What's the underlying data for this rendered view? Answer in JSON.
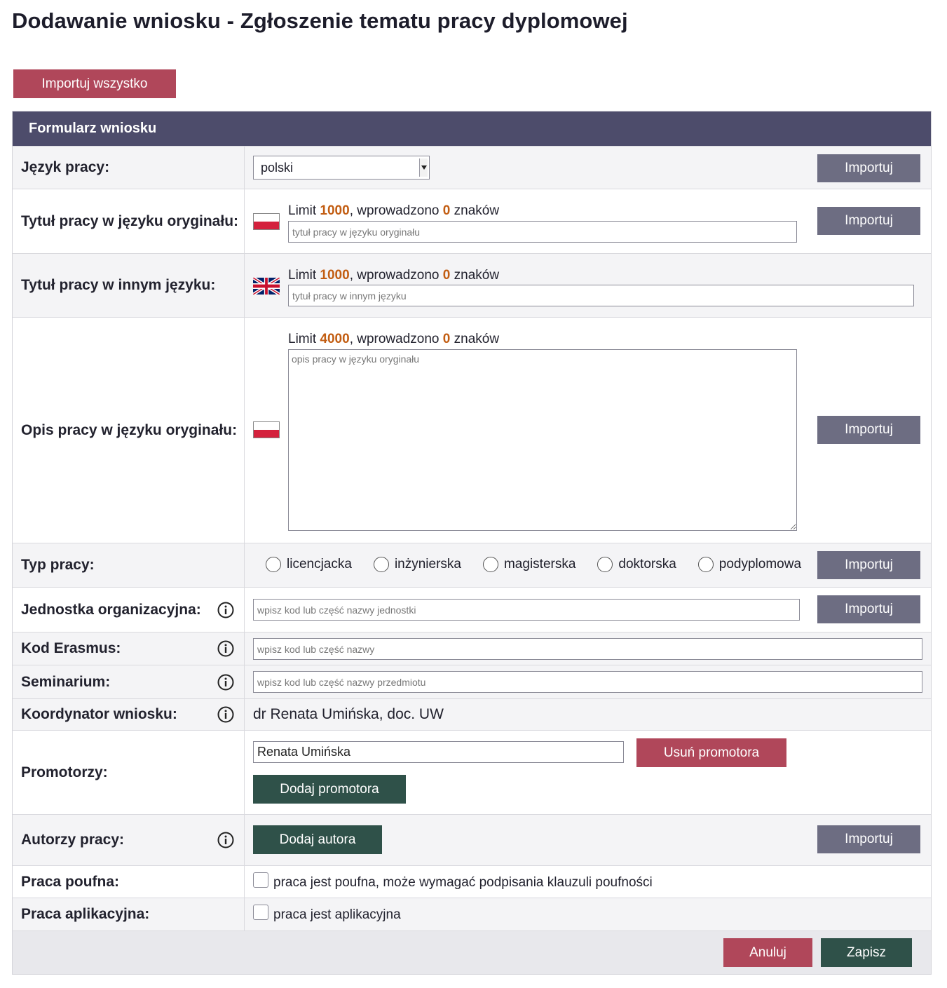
{
  "page": {
    "title": "Dodawanie wniosku - Zgłoszenie tematu pracy dyplomowej",
    "import_all_label": "Importuj wszystko"
  },
  "form": {
    "header": "Formularz wniosku",
    "import_label": "Importuj",
    "language": {
      "label": "Język pracy:",
      "selected": "polski"
    },
    "title_original": {
      "label": "Tytuł pracy w języku oryginału:",
      "limit_prefix": "Limit ",
      "limit": "1000",
      "entered_prefix": ", wprowadzono ",
      "entered": "0",
      "suffix": " znaków",
      "placeholder": "tytuł pracy w języku oryginału"
    },
    "title_other": {
      "label": "Tytuł pracy w innym języku:",
      "limit_prefix": "Limit ",
      "limit": "1000",
      "entered_prefix": ", wprowadzono ",
      "entered": "0",
      "suffix": " znaków",
      "placeholder": "tytuł pracy w innym języku"
    },
    "description": {
      "label": "Opis pracy w języku oryginału:",
      "limit_prefix": "Limit ",
      "limit": "4000",
      "entered_prefix": ", wprowadzono ",
      "entered": "0",
      "suffix": " znaków",
      "placeholder": "opis pracy w języku oryginału"
    },
    "thesis_type": {
      "label": "Typ pracy:",
      "options": [
        "licencjacka",
        "inżynierska",
        "magisterska",
        "doktorska",
        "podyplomowa"
      ]
    },
    "unit": {
      "label": "Jednostka organizacyjna:",
      "placeholder": "wpisz kod lub część nazwy jednostki"
    },
    "erasmus": {
      "label": "Kod Erasmus:",
      "placeholder": "wpisz kod lub część nazwy"
    },
    "seminar": {
      "label": "Seminarium:",
      "placeholder": "wpisz kod lub część nazwy przedmiotu"
    },
    "coordinator": {
      "label": "Koordynator wniosku:",
      "value": "dr Renata Umińska, doc. UW"
    },
    "supervisors": {
      "label": "Promotorzy:",
      "value": "Renata Umińska",
      "remove_label": "Usuń promotora",
      "add_label": "Dodaj promotora"
    },
    "authors": {
      "label": "Autorzy pracy:",
      "add_label": "Dodaj autora"
    },
    "confidential": {
      "label": "Praca poufna:",
      "checkbox_label": "praca jest poufna, może wymagać podpisania klauzuli poufności"
    },
    "applied": {
      "label": "Praca aplikacyjna:",
      "checkbox_label": "praca jest aplikacyjna"
    },
    "footer": {
      "cancel_label": "Anuluj",
      "save_label": "Zapisz"
    }
  },
  "colors": {
    "header_bg": "#4d4c6b",
    "accent_red": "#b0475a",
    "import_gray": "#6d6d82",
    "action_green": "#2f5149",
    "count_orange": "#c25d12"
  }
}
